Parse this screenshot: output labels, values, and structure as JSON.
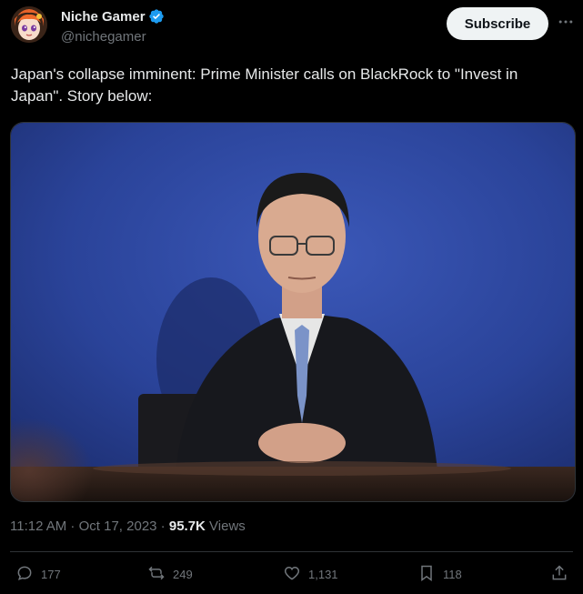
{
  "author": {
    "display_name": "Niche Gamer",
    "handle": "@nichegamer",
    "verified_icon": "verified-badge-icon"
  },
  "subscribe_label": "Subscribe",
  "more_icon": "more-options-icon",
  "tweet": {
    "text": "Japan's collapse imminent: Prime Minister calls on BlackRock to \"Invest in Japan\". Story below:"
  },
  "meta": {
    "time": "11:12 AM",
    "separator1": " · ",
    "date": "Oct 17, 2023",
    "separator2": " · ",
    "views_count": "95.7K",
    "views_label": " Views"
  },
  "actions": {
    "replies": "177",
    "reposts": "249",
    "likes": "1,131",
    "bookmarks": "118"
  },
  "colors": {
    "background": "#000000",
    "text": "#e7e9ea",
    "muted": "#71767b",
    "verified": "#1d9bf0",
    "button_bg": "#eff3f4"
  }
}
